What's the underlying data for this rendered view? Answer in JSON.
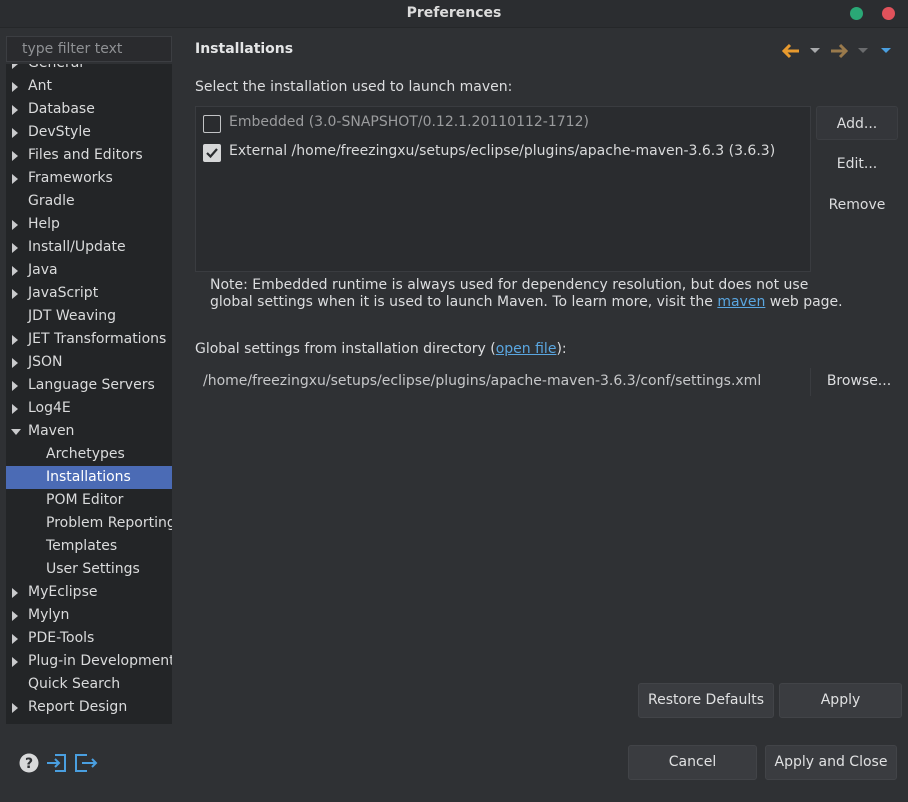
{
  "window": {
    "title": "Preferences",
    "controls": [
      "minimize",
      "close"
    ]
  },
  "filter": {
    "placeholder": "type filter text"
  },
  "tree": [
    {
      "label": "General",
      "expandable": true,
      "cut": true
    },
    {
      "label": "Ant",
      "expandable": true
    },
    {
      "label": "Database",
      "expandable": true
    },
    {
      "label": "DevStyle",
      "expandable": true
    },
    {
      "label": "Files and Editors",
      "expandable": true
    },
    {
      "label": "Frameworks",
      "expandable": true
    },
    {
      "label": "Gradle",
      "expandable": false
    },
    {
      "label": "Help",
      "expandable": true
    },
    {
      "label": "Install/Update",
      "expandable": true
    },
    {
      "label": "Java",
      "expandable": true
    },
    {
      "label": "JavaScript",
      "expandable": true
    },
    {
      "label": "JDT Weaving",
      "expandable": false
    },
    {
      "label": "JET Transformations",
      "expandable": true
    },
    {
      "label": "JSON",
      "expandable": true
    },
    {
      "label": "Language Servers",
      "expandable": true
    },
    {
      "label": "Log4E",
      "expandable": true
    },
    {
      "label": "Maven",
      "expandable": true,
      "expanded": true
    },
    {
      "label": "Archetypes",
      "child": true
    },
    {
      "label": "Installations",
      "child": true,
      "selected": true
    },
    {
      "label": "POM Editor",
      "child": true
    },
    {
      "label": "Problem Reporting",
      "child": true
    },
    {
      "label": "Templates",
      "child": true
    },
    {
      "label": "User Settings",
      "child": true
    },
    {
      "label": "MyEclipse",
      "expandable": true
    },
    {
      "label": "Mylyn",
      "expandable": true
    },
    {
      "label": "PDE-Tools",
      "expandable": true
    },
    {
      "label": "Plug-in Development",
      "expandable": true
    },
    {
      "label": "Quick Search",
      "expandable": false
    },
    {
      "label": "Report Design",
      "expandable": true
    }
  ],
  "page": {
    "heading": "Installations",
    "instruction": "Select the installation used to launch maven:",
    "installations": [
      {
        "label": "Embedded (3.0-SNAPSHOT/0.12.1.20110112-1712)",
        "checked": false
      },
      {
        "label": "External /home/freezingxu/setups/eclipse/plugins/apache-maven-3.6.3 (3.6.3)",
        "checked": true
      }
    ],
    "add_label": "Add...",
    "edit_label": "Edit...",
    "remove_label": "Remove",
    "note_line1": "Note: Embedded runtime is always used for dependency resolution, but does not use",
    "note_line2_prefix": "global settings when it is used to launch Maven. To learn more, visit the",
    "note_link": "maven",
    "note_line2_suffix": "web page.",
    "global_prefix": "Global settings from installation directory (",
    "global_link": "open file",
    "global_suffix": "):",
    "settings_path": "/home/freezingxu/setups/eclipse/plugins/apache-maven-3.6.3/conf/settings.xml",
    "browse_label": "Browse...",
    "restore_defaults_label": "Restore Defaults",
    "apply_label": "Apply"
  },
  "footer": {
    "cancel_label": "Cancel",
    "apply_close_label": "Apply and Close"
  },
  "colors": {
    "selection": "#4b6bb5",
    "back_arrow": "#e89a2e",
    "link": "#5aa6e0",
    "close_button": "#e0525b",
    "minimize_button": "#2aa876"
  }
}
